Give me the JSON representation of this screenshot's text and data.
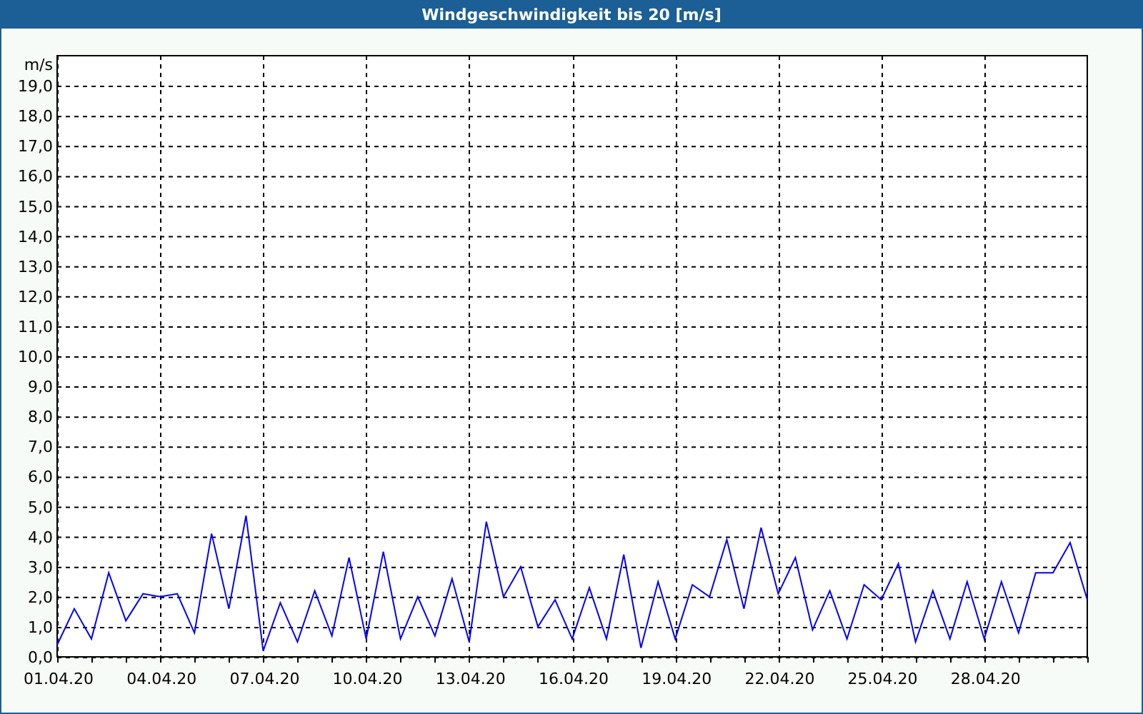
{
  "window": {
    "title": "Windgeschwindigkeit bis 20 [m/s]"
  },
  "chart": {
    "chart_data": {
      "type": "line",
      "grid": true,
      "ylabel": "m/s",
      "ylim": [
        0,
        20
      ],
      "categories": [
        "01.04.20",
        null,
        null,
        null,
        null,
        null,
        "04.04.20",
        null,
        null,
        null,
        null,
        null,
        "07.04.20",
        null,
        null,
        null,
        null,
        null,
        "10.04.20",
        null,
        null,
        null,
        null,
        null,
        "13.04.20",
        null,
        null,
        null,
        null,
        null,
        "16.04.20",
        null,
        null,
        null,
        null,
        null,
        "19.04.20",
        null,
        null,
        null,
        null,
        null,
        "22.04.20",
        null,
        null,
        null,
        null,
        null,
        "25.04.20",
        null,
        null,
        null,
        null,
        null,
        "28.04.20",
        null,
        null,
        null,
        null,
        null,
        null
      ],
      "series": [
        {
          "color": "#0000ff",
          "values": [
            0.4,
            1.6,
            0.6,
            2.8,
            1.2,
            2.1,
            2.0,
            2.1,
            0.8,
            4.1,
            1.6,
            4.7,
            0.2,
            1.8,
            0.5,
            2.2,
            0.7,
            3.3,
            0.6,
            3.5,
            0.6,
            2.0,
            0.7,
            2.6,
            0.5,
            4.5,
            2.0,
            3.0,
            1.0,
            1.9,
            0.6,
            2.3,
            0.6,
            3.4,
            0.3,
            2.5,
            0.6,
            2.4,
            2.0,
            3.9,
            1.6,
            4.3,
            2.1,
            3.3,
            0.9,
            2.2,
            0.6,
            2.4,
            1.9,
            3.1,
            0.5,
            2.2,
            0.6,
            2.5,
            0.6,
            2.5,
            0.8,
            2.8,
            2.8,
            3.8,
            1.9
          ]
        }
      ],
      "yticks": [
        {
          "value": 0,
          "label": "0,0"
        },
        {
          "value": 1,
          "label": "1,0"
        },
        {
          "value": 2,
          "label": "2,0"
        },
        {
          "value": 3,
          "label": "3,0"
        },
        {
          "value": 4,
          "label": "4,0"
        },
        {
          "value": 5,
          "label": "5,0"
        },
        {
          "value": 6,
          "label": "6,0"
        },
        {
          "value": 7,
          "label": "7,0"
        },
        {
          "value": 8,
          "label": "8,0"
        },
        {
          "value": 9,
          "label": "9,0"
        },
        {
          "value": 10,
          "label": "10,0"
        },
        {
          "value": 11,
          "label": "11,0"
        },
        {
          "value": 12,
          "label": "12,0"
        },
        {
          "value": 13,
          "label": "13,0"
        },
        {
          "value": 14,
          "label": "14,0"
        },
        {
          "value": 15,
          "label": "15,0"
        },
        {
          "value": 16,
          "label": "16,0"
        },
        {
          "value": 17,
          "label": "17,0"
        },
        {
          "value": 18,
          "label": "18,0"
        },
        {
          "value": 19,
          "label": "19,0"
        }
      ]
    }
  }
}
